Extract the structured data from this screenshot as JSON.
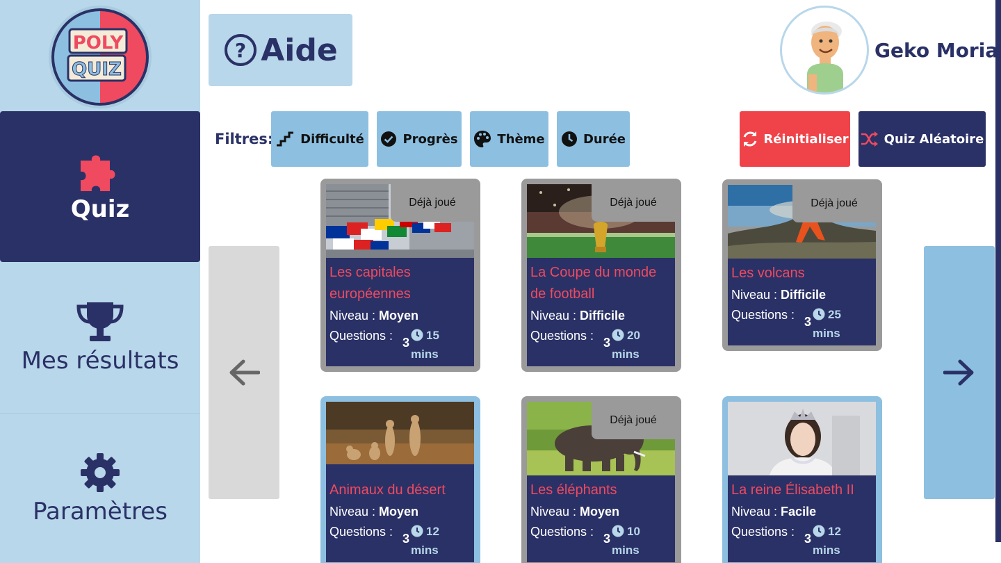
{
  "logo": {
    "line1": "POLY",
    "line2": "QUIZ"
  },
  "nav": {
    "quiz": "Quiz",
    "results": "Mes résultats",
    "settings": "Paramètres"
  },
  "header": {
    "help_label": "Aide"
  },
  "profile": {
    "name": "Geko Moria"
  },
  "filters": {
    "label": "Filtres:",
    "items": [
      "Difficulté",
      "Progrès",
      "Thème",
      "Durée"
    ],
    "reset": "Réinitialiser",
    "random": "Quiz Aléatoire"
  },
  "played_badge": "Déjà joué",
  "level_prefix": "Niveau : ",
  "questions_label": "Questions :",
  "colors": {
    "navy": "#2a3166",
    "light_blue": "#b8d7ea",
    "mid_blue": "#8dbfe0",
    "red": "#ef4349",
    "pink_title": "#ef4a60",
    "grey": "#9a9a9a"
  },
  "quizzes": [
    {
      "title": "Les capitales européennes",
      "level": "Moyen",
      "questions": "3",
      "time": "15",
      "unit": "mins",
      "played": true,
      "image": "flags"
    },
    {
      "title": "La Coupe du monde de football",
      "level": "Difficile",
      "questions": "3",
      "time": "20",
      "unit": "mins",
      "played": true,
      "image": "stadium"
    },
    {
      "title": "Les volcans",
      "level": "Difficile",
      "questions": "3",
      "time": "25",
      "unit": "mins",
      "played": true,
      "image": "volcano"
    },
    {
      "title": "Animaux du désert",
      "level": "Moyen",
      "questions": "3",
      "time": "12",
      "unit": "mins",
      "played": false,
      "image": "meerkats"
    },
    {
      "title": "Les éléphants",
      "level": "Moyen",
      "questions": "3",
      "time": "10",
      "unit": "mins",
      "played": true,
      "image": "elephant"
    },
    {
      "title": "La reine Élisabeth II",
      "level": "Facile",
      "questions": "3",
      "time": "12",
      "unit": "mins",
      "played": false,
      "image": "queen"
    }
  ]
}
